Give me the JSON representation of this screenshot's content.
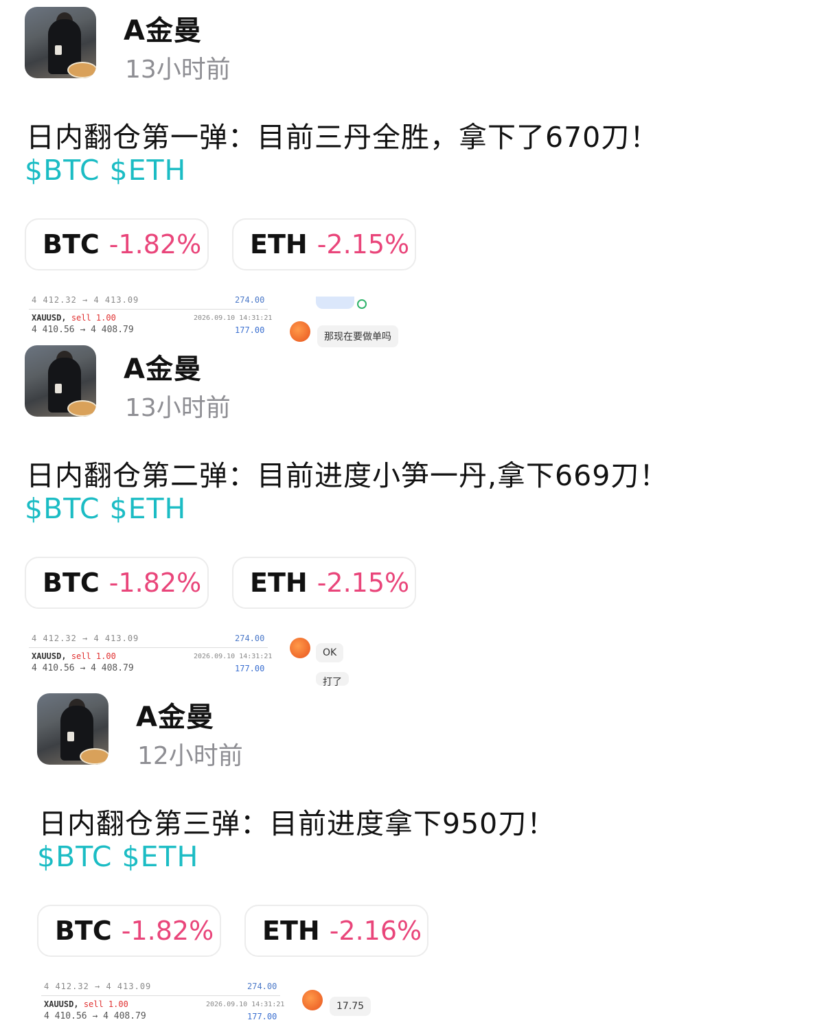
{
  "posts": [
    {
      "username": "A金曼",
      "time": "13小时前",
      "text": "日内翻仓第一弹：目前三丹全胜，拿下了670刀！",
      "tags": [
        "$BTC",
        "$ETH"
      ],
      "chips": [
        {
          "symbol": "BTC",
          "change": "-1.82%"
        },
        {
          "symbol": "ETH",
          "change": "-2.15%"
        }
      ],
      "trade": {
        "cut_text": "4 412.32 → 4 413.09",
        "cut_profit": "274.00",
        "pair": "XAUUSD,",
        "side": "sell 1.00",
        "prices": "4 410.56 → 4 408.79",
        "date": "2026.09.10 14:31:21",
        "profit": "177.00"
      },
      "chat": [
        "那现在要做单吗"
      ]
    },
    {
      "username": "A金曼",
      "time": "13小时前",
      "text": "日内翻仓第二弹：目前进度小笋一丹,拿下669刀！",
      "tags": [
        "$BTC",
        "$ETH"
      ],
      "chips": [
        {
          "symbol": "BTC",
          "change": "-1.82%"
        },
        {
          "symbol": "ETH",
          "change": "-2.15%"
        }
      ],
      "trade": {
        "cut_text": "4 412.32 → 4 413.09",
        "cut_profit": "274.00",
        "pair": "XAUUSD,",
        "side": "sell 1.00",
        "prices": "4 410.56 → 4 408.79",
        "date": "2026.09.10 14:31:21",
        "profit": "177.00"
      },
      "chat": [
        "OK",
        "打了"
      ]
    },
    {
      "username": "A金曼",
      "time": "12小时前",
      "text": "日内翻仓第三弹：目前进度拿下950刀！",
      "tags": [
        "$BTC",
        "$ETH"
      ],
      "chips": [
        {
          "symbol": "BTC",
          "change": "-1.82%"
        },
        {
          "symbol": "ETH",
          "change": "-2.16%"
        }
      ],
      "trade": {
        "cut_text": "4 412.32 → 4 413.09",
        "cut_profit": "274.00",
        "pair": "XAUUSD,",
        "side": "sell 1.00",
        "prices": "4 410.56 → 4 408.79",
        "date": "2026.09.10 14:31:21",
        "profit": "177.00"
      },
      "chat": [
        "17.75"
      ]
    }
  ],
  "colors": {
    "tag": "#1bbcc4",
    "negative": "#e9457a",
    "muted": "#8e8e93"
  }
}
